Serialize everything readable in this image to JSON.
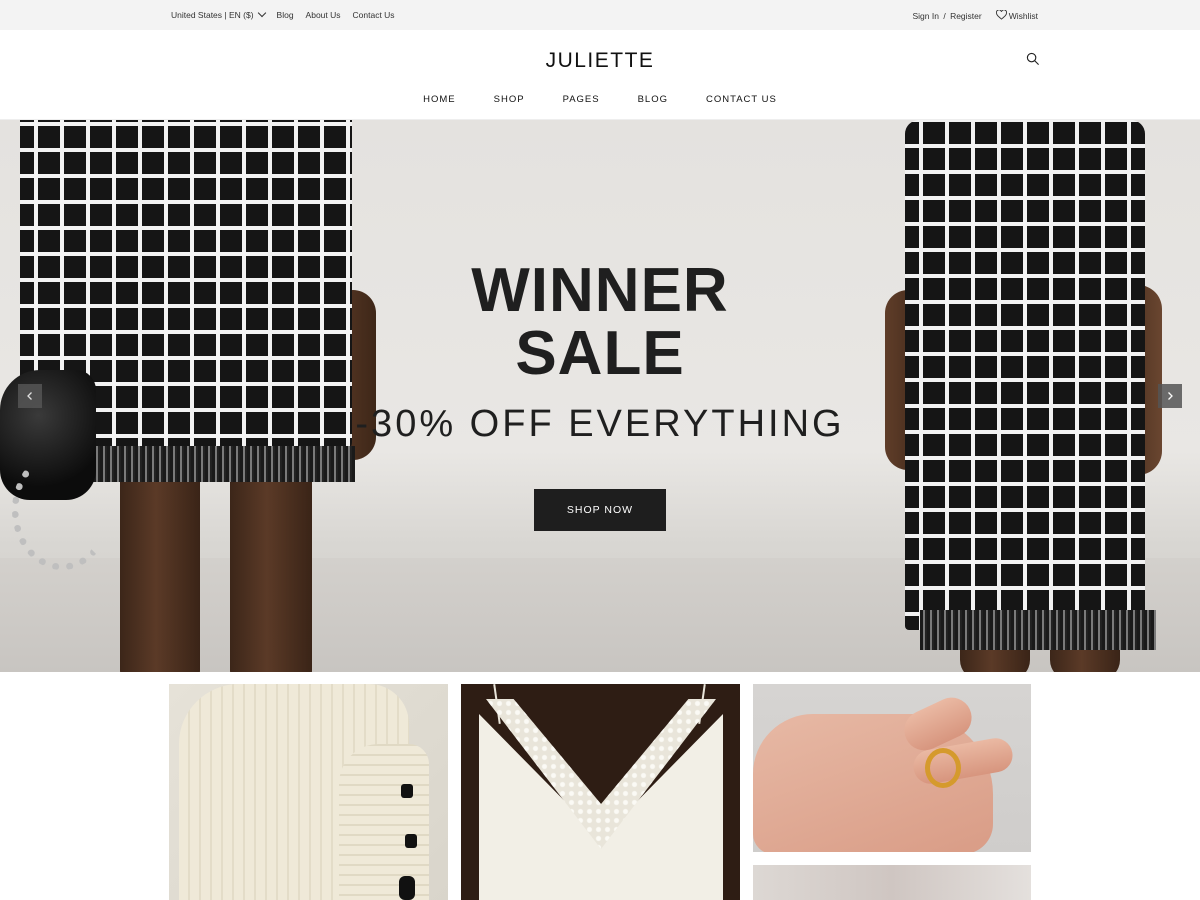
{
  "topbar": {
    "locale": "United States | EN ($)",
    "links": [
      "Blog",
      "About Us",
      "Contact Us"
    ],
    "signin": "Sign In",
    "separator": "/",
    "register": "Register",
    "wishlist": "Wishlist"
  },
  "header": {
    "logo": "JULIETTE",
    "nav": [
      "HOME",
      "SHOP",
      "PAGES",
      "BLOG",
      "CONTACT US"
    ]
  },
  "hero": {
    "title_line1": "WINNER",
    "title_line2": "SALE",
    "subtitle": "-30% OFF EVERYTHING",
    "cta": "SHOP NOW",
    "prev_icon": "chevron-left-icon",
    "next_icon": "chevron-right-icon"
  },
  "colors": {
    "topbar_bg": "#f3f3f3",
    "button_bg": "#1e1e1e",
    "hero_text": "#1f1f1f"
  }
}
